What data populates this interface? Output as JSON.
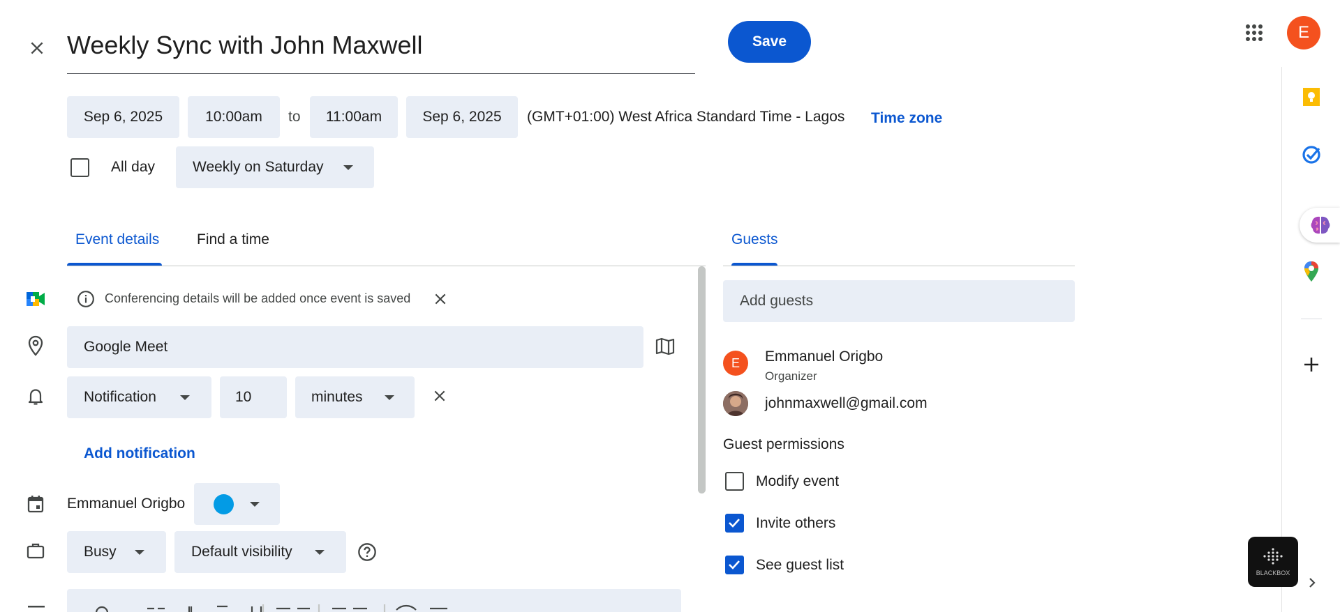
{
  "header": {
    "title": "Weekly Sync with John Maxwell",
    "save_label": "Save",
    "avatar_letter": "E"
  },
  "datetime": {
    "start_date": "Sep 6, 2025",
    "start_time": "10:00am",
    "to_label": "to",
    "end_time": "11:00am",
    "end_date": "Sep 6, 2025",
    "timezone_text": "(GMT+01:00) West Africa Standard Time - Lagos",
    "timezone_link": "Time zone",
    "all_day_label": "All day",
    "all_day_checked": false,
    "recurrence": "Weekly on Saturday"
  },
  "tabs": {
    "event_details": "Event details",
    "find_time": "Find a time",
    "guests": "Guests"
  },
  "details": {
    "conferencing_note": "Conferencing details will be added once event is saved",
    "location": "Google Meet",
    "notification_type": "Notification",
    "notification_value": "10",
    "notification_unit": "minutes",
    "add_notification": "Add notification",
    "calendar_owner": "Emmanuel Origbo",
    "calendar_color": "#039be5",
    "availability": "Busy",
    "visibility": "Default visibility"
  },
  "guests": {
    "add_placeholder": "Add guests",
    "list": [
      {
        "name": "Emmanuel Origbo",
        "role": "Organizer",
        "avatar_letter": "E",
        "avatar_color": "#f4511e"
      },
      {
        "name": "johnmaxwell@gmail.com",
        "role": "",
        "avatar_letter": "",
        "avatar_color": "#5d4037"
      }
    ],
    "permissions_title": "Guest permissions",
    "permissions": [
      {
        "label": "Modify event",
        "checked": false
      },
      {
        "label": "Invite others",
        "checked": true
      },
      {
        "label": "See guest list",
        "checked": true
      }
    ]
  },
  "side_panel": {
    "icons": [
      "keep-icon",
      "tasks-icon",
      "brain-extension-icon",
      "maps-icon",
      "add-icon"
    ],
    "blackbox_label": "BLACKBOX"
  },
  "colors": {
    "accent": "#0b57d0",
    "chip_bg": "#e9eef6",
    "avatar": "#f4511e"
  }
}
